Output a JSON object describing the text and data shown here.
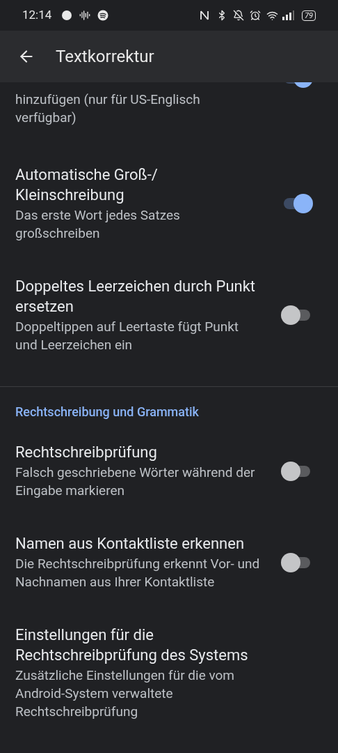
{
  "status_bar": {
    "time": "12:14",
    "battery": "79"
  },
  "app_bar": {
    "title": "Textkorrektur"
  },
  "rows": [
    {
      "kind": "setting_cut",
      "summary": "hinzufügen (nur für US-Englisch verfügbar)",
      "toggle": {
        "on": true
      }
    },
    {
      "kind": "setting",
      "title": "Automatische Groß-/ Kleinschreibung",
      "summary": "Das erste Wort jedes Satzes großschreiben",
      "toggle": {
        "on": true
      }
    },
    {
      "kind": "setting",
      "title": "Doppeltes Leerzeichen durch Punkt ersetzen",
      "summary": "Doppeltippen auf Leertaste fügt Punkt und Leerzeichen ein",
      "toggle": {
        "on": false
      }
    },
    {
      "kind": "divider"
    },
    {
      "kind": "section",
      "label": "Rechtschreibung und Grammatik"
    },
    {
      "kind": "setting",
      "title": "Rechtschreibprüfung",
      "summary": "Falsch geschriebene Wörter während der Eingabe markieren",
      "toggle": {
        "on": false
      }
    },
    {
      "kind": "setting",
      "title": "Namen aus Kontaktliste erkennen",
      "summary": "Die Rechtschreibprüfung erkennt Vor- und Nachnamen aus Ihrer Kontaktliste",
      "toggle": {
        "on": false
      }
    },
    {
      "kind": "setting",
      "title": "Einstellungen für die Rechtschreibprüfung des Systems",
      "summary": "Zusätzliche Einstellungen für die vom Android-System verwaltete Rechtschreibprüfung"
    }
  ]
}
